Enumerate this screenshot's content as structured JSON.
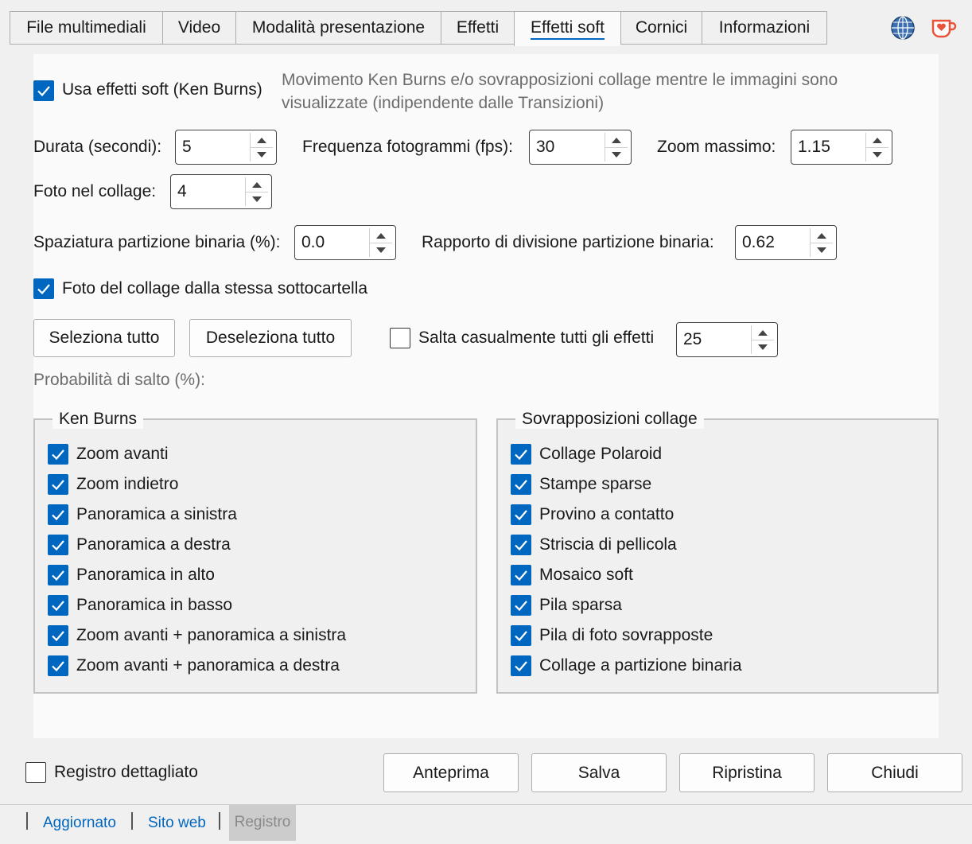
{
  "tabs": [
    {
      "label": "File multimediali"
    },
    {
      "label": "Video"
    },
    {
      "label": "Modalità presentazione"
    },
    {
      "label": "Effetti"
    },
    {
      "label": "Effetti soft"
    },
    {
      "label": "Cornici"
    },
    {
      "label": "Informazioni"
    }
  ],
  "active_tab": "Effetti soft",
  "icons": {
    "globe": "globe-icon",
    "coffee": "coffee-heart-icon"
  },
  "colors": {
    "accent": "#0067c0",
    "coffee": "#e8533a"
  },
  "soft": {
    "use_label": "Usa effetti soft (Ken Burns)",
    "use_checked": true,
    "description": "Movimento Ken Burns e/o sovrapposizioni collage mentre le immagini sono visualizzate (indipendente dalle Transizioni)",
    "duration_label": "Durata (secondi):",
    "duration_value": "5",
    "fps_label": "Frequenza fotogrammi (fps):",
    "fps_value": "30",
    "zoom_label": "Zoom massimo:",
    "zoom_value": "1.15",
    "collage_photos_label": "Foto nel collage:",
    "collage_photos_value": "4",
    "bsp_spacing_label": "Spaziatura partizione binaria (%):",
    "bsp_spacing_value": "0.0",
    "bsp_ratio_label": "Rapporto di divisione partizione binaria:",
    "bsp_ratio_value": "0.62",
    "same_folder_label": "Foto del collage dalla stessa sottocartella",
    "same_folder_checked": true,
    "select_all": "Seleziona tutto",
    "deselect_all": "Deseleziona tutto",
    "random_skip_label": "Salta casualmente tutti gli effetti",
    "random_skip_checked": false,
    "skip_value": "25",
    "skip_prob_label": "Probabilità di salto (%):"
  },
  "ken_burns": {
    "title": "Ken Burns",
    "items": [
      {
        "label": "Zoom avanti",
        "checked": true
      },
      {
        "label": "Zoom indietro",
        "checked": true
      },
      {
        "label": "Panoramica a sinistra",
        "checked": true
      },
      {
        "label": "Panoramica a destra",
        "checked": true
      },
      {
        "label": "Panoramica in alto",
        "checked": true
      },
      {
        "label": "Panoramica in basso",
        "checked": true
      },
      {
        "label": "Zoom avanti + panoramica a sinistra",
        "checked": true
      },
      {
        "label": "Zoom avanti + panoramica a destra",
        "checked": true
      }
    ]
  },
  "collage": {
    "title": "Sovrapposizioni collage",
    "items": [
      {
        "label": "Collage Polaroid",
        "checked": true
      },
      {
        "label": "Stampe sparse",
        "checked": true
      },
      {
        "label": "Provino a contatto",
        "checked": true
      },
      {
        "label": "Striscia di pellicola",
        "checked": true
      },
      {
        "label": "Mosaico soft",
        "checked": true
      },
      {
        "label": "Pila sparsa",
        "checked": true
      },
      {
        "label": "Pila di foto sovrapposte",
        "checked": true
      },
      {
        "label": "Collage a partizione binaria",
        "checked": true
      }
    ]
  },
  "footer": {
    "verbose_log_label": "Registro dettagliato",
    "verbose_log_checked": false,
    "preview": "Anteprima",
    "save": "Salva",
    "reset": "Ripristina",
    "close": "Chiudi"
  },
  "statusbar": {
    "updated": "Aggiornato",
    "website": "Sito web",
    "log": "Registro"
  }
}
